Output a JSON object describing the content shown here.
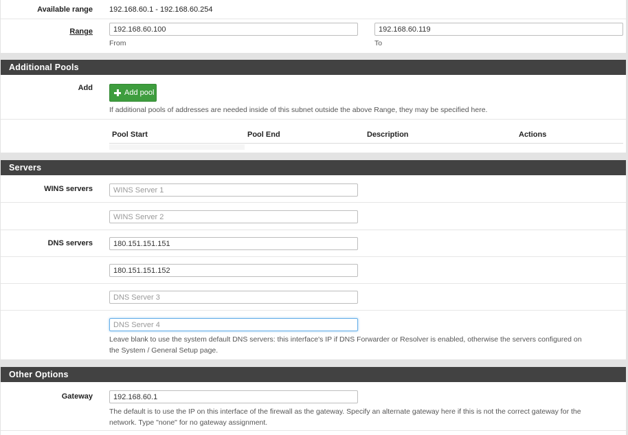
{
  "range_section": {
    "available_range_label": "Available range",
    "available_range_value": "192.168.60.1 - 192.168.60.254",
    "range_label": "Range",
    "from_value": "192.168.60.100",
    "from_help": "From",
    "to_value": "192.168.60.119",
    "to_help": "To"
  },
  "additional_pools": {
    "title": "Additional Pools",
    "add_label": "Add",
    "add_button": "Add pool",
    "help": "If additional pools of addresses are needed inside of this subnet outside the above Range, they may be specified here.",
    "columns": [
      "Pool Start",
      "Pool End",
      "Description",
      "Actions"
    ]
  },
  "servers": {
    "title": "Servers",
    "wins_label": "WINS servers",
    "wins1_placeholder": "WINS Server 1",
    "wins2_placeholder": "WINS Server 2",
    "dns_label": "DNS servers",
    "dns1_value": "180.151.151.151",
    "dns2_value": "180.151.151.152",
    "dns3_placeholder": "DNS Server 3",
    "dns4_placeholder": "DNS Server 4",
    "dns_help_1": "Leave blank to use the system default DNS servers: this interface's IP if DNS Forwarder or Resolver is enabled, otherwise the servers configured on",
    "dns_help_2": "the System / General Setup page."
  },
  "other_options": {
    "title": "Other Options",
    "gateway_label": "Gateway",
    "gateway_value": "192.168.60.1",
    "gateway_help_1": "The default is to use the IP on this interface of the firewall as the gateway. Specify an alternate gateway here if this is not the correct gateway for the",
    "gateway_help_2": "network. Type \"none\" for no gateway assignment."
  },
  "colors": {
    "heading_bg": "#424242",
    "add_button_bg": "#3e9d3e",
    "focus_border": "#66afe9"
  }
}
